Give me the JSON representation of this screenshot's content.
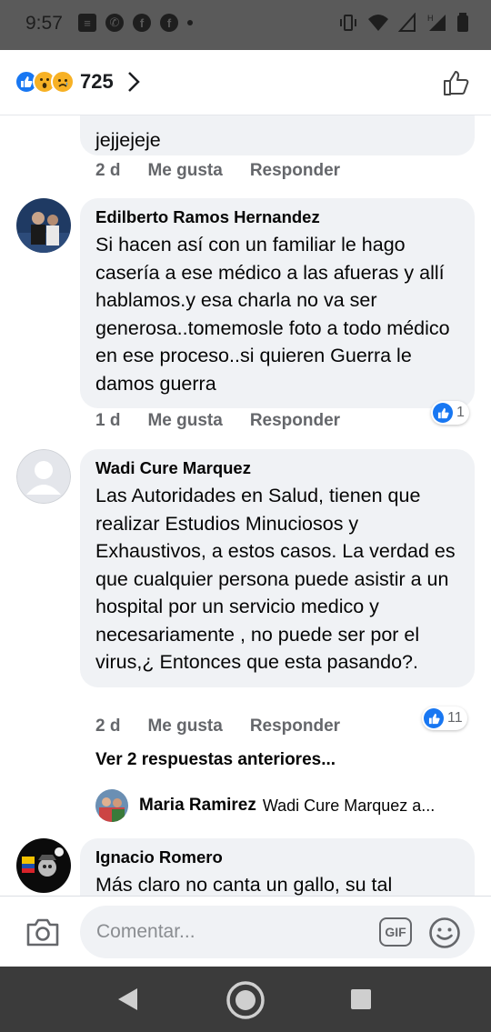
{
  "status_bar": {
    "time": "9:57"
  },
  "header": {
    "reaction_count": "725"
  },
  "comments": [
    {
      "partial_text": "jejjejeje",
      "time": "2 d",
      "like_label": "Me gusta",
      "reply_label": "Responder"
    },
    {
      "name": "Edilberto Ramos Hernandez",
      "text": "Si hacen así con un familiar le hago casería a ese médico a las afueras y allí hablamos.y esa charla no va ser generosa..tomemosle foto a todo médico en ese proceso..si quieren Guerra le damos guerra",
      "time": "1 d",
      "like_label": "Me gusta",
      "reply_label": "Responder",
      "likes": "1"
    },
    {
      "name": "Wadi Cure Marquez",
      "text": "Las Autoridades en Salud, tienen que realizar Estudios Minuciosos y Exhaustivos,  a estos casos. La verdad es que cualquier persona puede asistir  a un hospital por un servicio medico y necesariamente , no puede ser por el virus,¿ Entonces que esta pasando?.",
      "time": "2 d",
      "like_label": "Me gusta",
      "reply_label": "Responder",
      "likes": "11",
      "previous_replies": "Ver 2 respuestas anteriores...",
      "reply": {
        "name": "Maria Ramirez",
        "text": "Wadi Cure Marquez a..."
      }
    },
    {
      "name": "Ignacio Romero",
      "text": "Más claro no canta un gallo, su tal"
    }
  ],
  "composer": {
    "placeholder": "Comentar...",
    "gif_label": "GIF"
  },
  "colors": {
    "like_blue": "#1877f2",
    "bubble_bg": "#f0f2f5",
    "meta_gray": "#65676b"
  }
}
